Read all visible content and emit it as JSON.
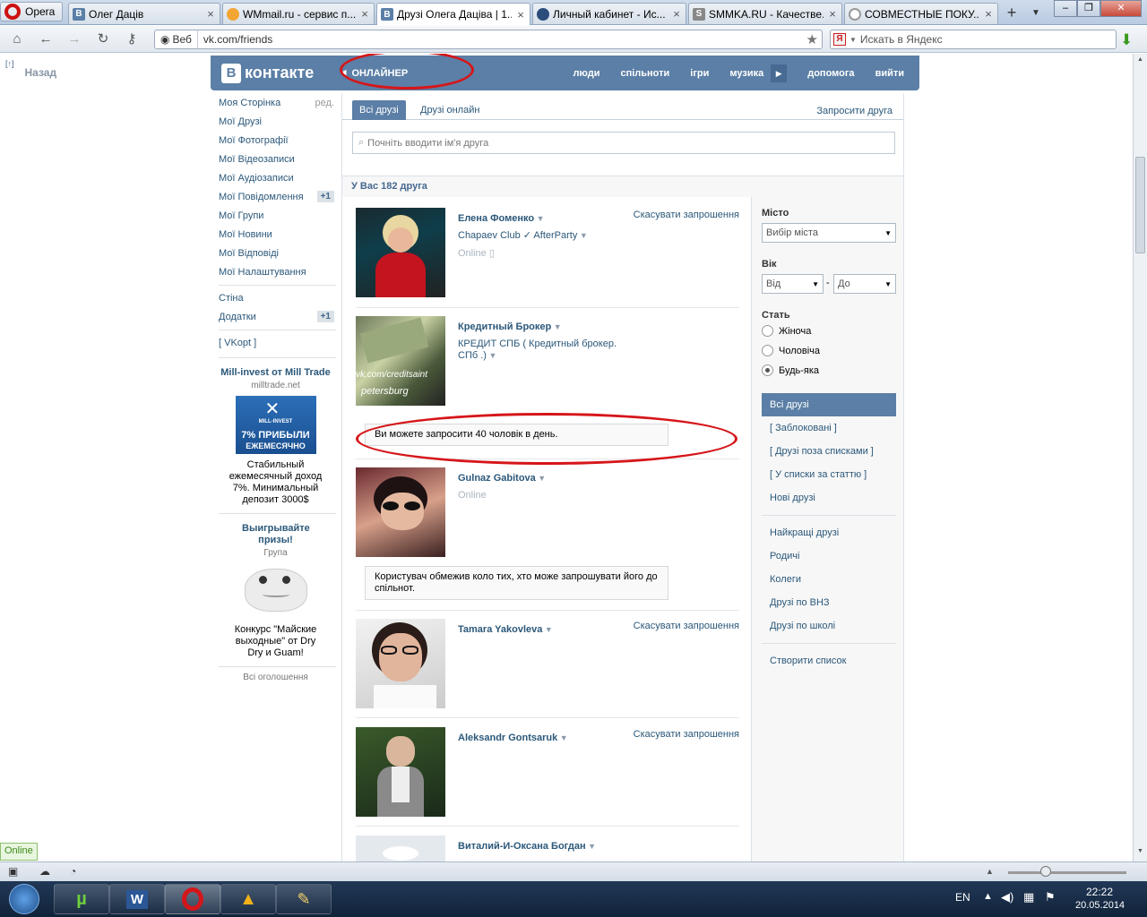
{
  "browser": {
    "menu_label": "Opera",
    "tabs": [
      {
        "title": "Олег Дацiв",
        "favicon": "vk-icon"
      },
      {
        "title": "WMmail.ru - сервис п...",
        "favicon": "wmmail-icon"
      },
      {
        "title": "Друзі Олега Даціва | 1...",
        "favicon": "vk-icon",
        "active": true
      },
      {
        "title": "Личный кабинет - Ис...",
        "favicon": "globe-icon"
      },
      {
        "title": "SMMKA.RU - Качестве...",
        "favicon": "smmka-icon"
      },
      {
        "title": "СОВМЕСТНЫЕ ПОКУ...",
        "favicon": "loading-icon"
      }
    ],
    "address": {
      "web_label": "Веб",
      "url": "vk.com/friends"
    },
    "search_placeholder": "Искать в Яндекс",
    "status_online": "Online"
  },
  "vk": {
    "back_label": "Назад",
    "back_icon_text": "[↑]",
    "logo_text": "контакте",
    "logo_letter": "В",
    "player_label": "ОНЛАЙНЕР",
    "top_menu": [
      "люди",
      "спільноти",
      "ігри",
      "музика",
      "допомога",
      "вийти"
    ],
    "left_nav": [
      {
        "label": "Моя Сторінка",
        "extra": "ред."
      },
      {
        "label": "Мої Друзі"
      },
      {
        "label": "Мої Фотографії"
      },
      {
        "label": "Мої Відеозаписи"
      },
      {
        "label": "Мої Аудіозаписи"
      },
      {
        "label": "Мої Повідомлення",
        "count": "+1"
      },
      {
        "label": "Мої Групи"
      },
      {
        "label": "Мої Новини"
      },
      {
        "label": "Мої Відповіді"
      },
      {
        "label": "Мої Налаштування"
      }
    ],
    "left_nav2": [
      {
        "label": "Стіна"
      },
      {
        "label": "Додатки",
        "count": "+1"
      }
    ],
    "vkopt": "[ VKopt ]",
    "ads": [
      {
        "title": "Mill-invest от Mill Trade",
        "sub": "milltrade.net",
        "banner_top": "MILL-INVEST",
        "banner_mid": "7% ПРИБЫЛИ",
        "banner_bot": "ЕЖЕМЕСЯЧНО",
        "desc": "Стабильный ежемесячный доход 7%. Минимальный депозит 3000$"
      },
      {
        "title": "Выигрывайте призы!",
        "sub": "Група",
        "desc": "Конкурс \"Майские выходные\" от Dry Dry и Guam!"
      }
    ],
    "all_ads": "Всі оголошення",
    "friends_tabs": {
      "all": "Всі друзі",
      "online": "Друзі онлайн",
      "invite": "Запросити друга"
    },
    "search_placeholder": "Почніть вводити ім'я друга",
    "count_text": "У Вас 182 друга",
    "friends": [
      {
        "name": "Елена Фоменко",
        "sub": "Chapaev Club ✓ AfterParty",
        "online": "Online",
        "cancel": "Скасувати запрошення"
      },
      {
        "name": "Кредитный Брокер",
        "sub": "КРЕДИТ СПБ ( Кредитный брокер. СПб .)",
        "cancel": "",
        "photo_text1": "vk.com/creditsaint",
        "photo_text2": "petersburg"
      },
      {
        "name": "Gulnaz Gabitova",
        "online": "Online",
        "cancel": ""
      },
      {
        "name": "Tamara Yakovleva",
        "cancel": "Скасувати запрошення"
      },
      {
        "name": "Aleksandr Gontsaruk",
        "cancel": "Скасувати запрошення"
      },
      {
        "name": "Виталий-И-Оксана Богдан",
        "cancel": ""
      }
    ],
    "notices": [
      "Ви можете запросити 40 чоловік в день.",
      "Користувач обмежив коло тих, хто може запрошувати його до спільнот."
    ],
    "filters": {
      "city_label": "Місто",
      "city_select": "Вибір міста",
      "age_label": "Вік",
      "age_from": "Від",
      "age_dash": "-",
      "age_to": "До",
      "gender_label": "Стать",
      "gender_options": [
        "Жіноча",
        "Чоловіча",
        "Будь-яка"
      ],
      "gender_selected": "Будь-яка"
    },
    "lists1": [
      "Всі друзі",
      "[ Заблоковані ]",
      "[ Друзі поза списками ]",
      "[ У списки за статтю ]",
      "Нові друзі"
    ],
    "lists2": [
      "Найкращі друзі",
      "Родичі",
      "Колеги",
      "Друзі по ВНЗ",
      "Друзі по школі"
    ],
    "lists3": [
      "Створити список"
    ]
  },
  "taskbar": {
    "lang": "EN",
    "time": "22:22",
    "date": "20.05.2014"
  },
  "colors": {
    "vk_blue": "#5b7fa6",
    "link": "#2b587a",
    "annotation_red": "#d6161a"
  }
}
